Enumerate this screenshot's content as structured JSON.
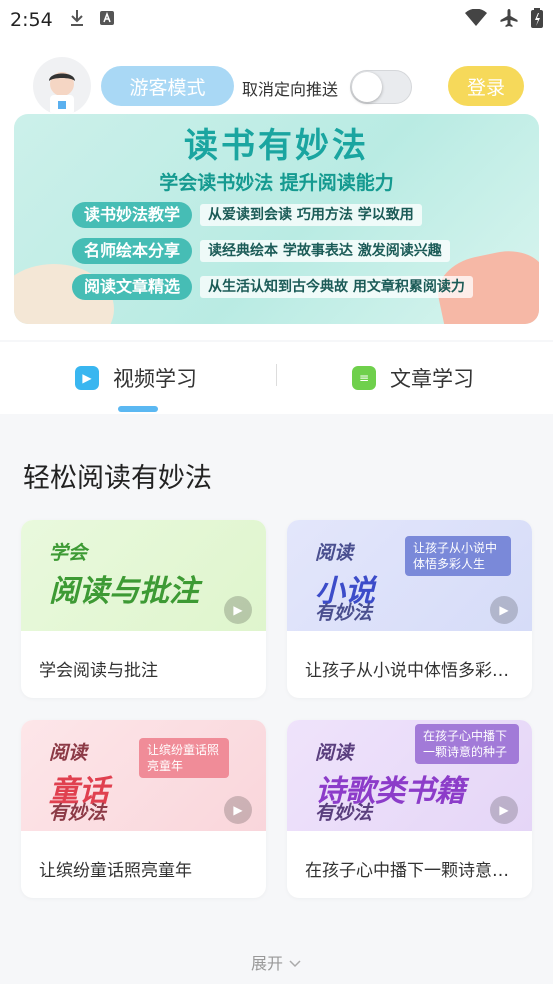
{
  "status_bar": {
    "time": "2:54",
    "icons": [
      "download-icon",
      "a-icon",
      "wifi-icon",
      "airplane-icon",
      "battery-icon"
    ]
  },
  "header": {
    "guest_mode": "游客模式",
    "toggle_label": "取消定向推送",
    "toggle_on": false,
    "login": "登录"
  },
  "banner": {
    "title": "读书有妙法",
    "subtitle": "学会读书妙法 提升阅读能力",
    "rows": [
      {
        "tag": "读书妙法教学",
        "desc": "从爱读到会读 巧用方法 学以致用"
      },
      {
        "tag": "名师绘本分享",
        "desc": "读经典绘本 学故事表达 激发阅读兴趣"
      },
      {
        "tag": "阅读文章精选",
        "desc": "从生活认知到古今典故 用文章积累阅读力"
      }
    ]
  },
  "tabs": [
    {
      "label": "视频学习",
      "active": true,
      "icon": "tv-icon"
    },
    {
      "label": "文章学习",
      "active": false,
      "icon": "document-icon"
    }
  ],
  "section": {
    "title": "轻松阅读有妙法"
  },
  "cards": [
    {
      "thumb_line1": "学会",
      "thumb_line2": "阅读与批注",
      "thumb_line3": "",
      "bubble": "",
      "caption": "学会阅读与批注"
    },
    {
      "thumb_line1": "阅读",
      "thumb_line2": "小说",
      "thumb_line3": "有妙法",
      "bubble": "让孩子从小说中体悟多彩人生",
      "caption": "让孩子从小说中体悟多彩人生"
    },
    {
      "thumb_line1": "阅读",
      "thumb_line2": "童话",
      "thumb_line3": "有妙法",
      "bubble": "让缤纷童话照亮童年",
      "caption": "让缤纷童话照亮童年"
    },
    {
      "thumb_line1": "阅读",
      "thumb_line2": "诗歌类书籍",
      "thumb_line3": "有妙法",
      "bubble": "在孩子心中播下一颗诗意的种子",
      "caption": "在孩子心中播下一颗诗意的种子"
    }
  ],
  "footer": {
    "expand": "展开"
  }
}
